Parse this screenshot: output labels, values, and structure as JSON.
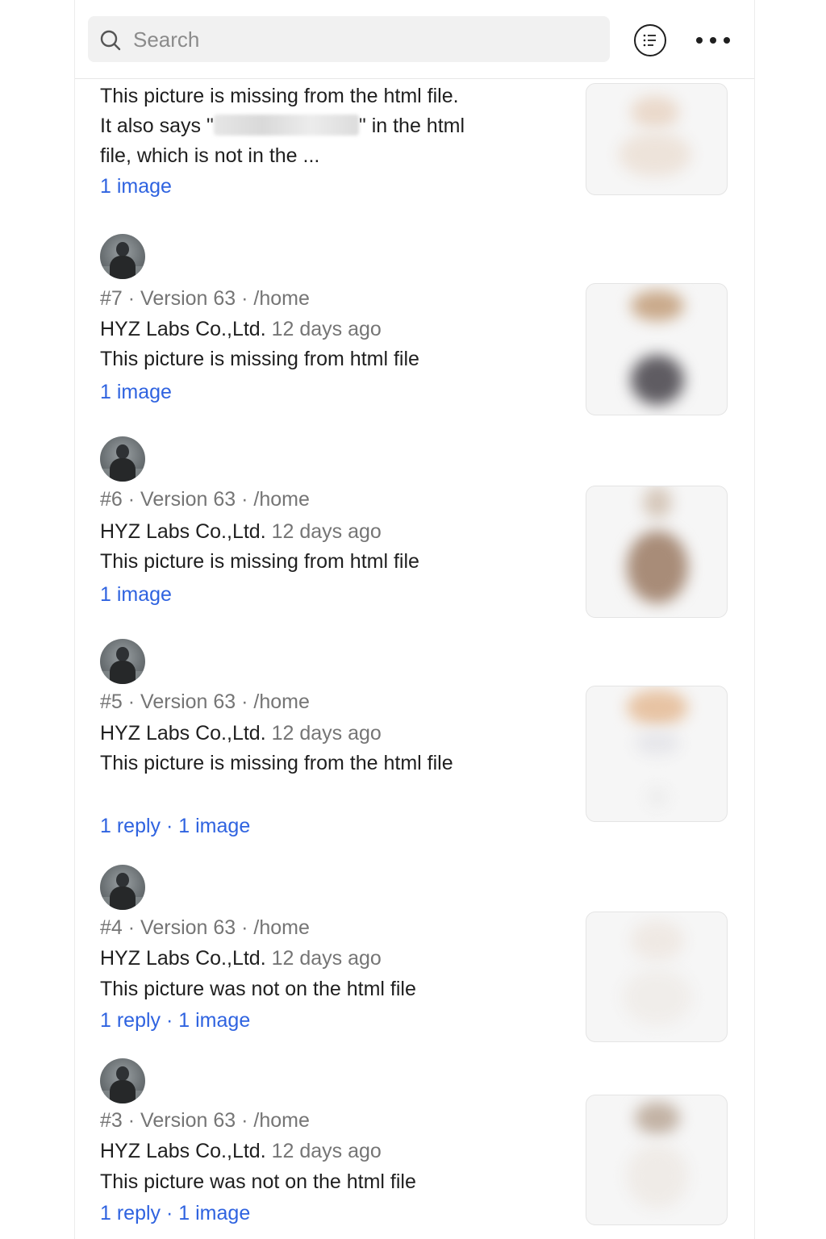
{
  "search": {
    "placeholder": "Search"
  },
  "icons": {
    "search": "search-icon",
    "filter": "filter-list-icon",
    "more": "more-horizontal-icon"
  },
  "colors": {
    "link": "#2f63e0",
    "meta": "#757575",
    "text": "#1f1f1f"
  },
  "first_comment": {
    "text_a": "This picture is missing from the html file. It also says \"",
    "text_b": "\" in the html file, which is not in the ...",
    "image_link": "1 image"
  },
  "comments": [
    {
      "number": "#7",
      "version": "Version 63",
      "path": "/home",
      "author": "HYZ Labs Co.,Ltd.",
      "time": "12 days ago",
      "text": "This picture is missing from html file",
      "image_link": "1 image"
    },
    {
      "number": "#6",
      "version": "Version 63",
      "path": "/home",
      "author": "HYZ Labs Co.,Ltd.",
      "time": "12 days ago",
      "text": "This picture is missing from html file",
      "image_link": "1 image"
    },
    {
      "number": "#5",
      "version": "Version 63",
      "path": "/home",
      "author": "HYZ Labs Co.,Ltd.",
      "time": "12 days ago",
      "text": "This picture is missing from the html file",
      "reply_link": "1 reply",
      "image_link": "1 image"
    },
    {
      "number": "#4",
      "version": "Version 63",
      "path": "/home",
      "author": "HYZ Labs Co.,Ltd.",
      "time": "12 days ago",
      "text": "This picture was not on the html file",
      "reply_link": "1 reply",
      "image_link": "1 image"
    },
    {
      "number": "#3",
      "version": "Version 63",
      "path": "/home",
      "author": "HYZ Labs Co.,Ltd.",
      "time": "12 days ago",
      "text": "This picture was not on the html file",
      "reply_link": "1 reply",
      "image_link": "1 image"
    }
  ],
  "separator": "·"
}
